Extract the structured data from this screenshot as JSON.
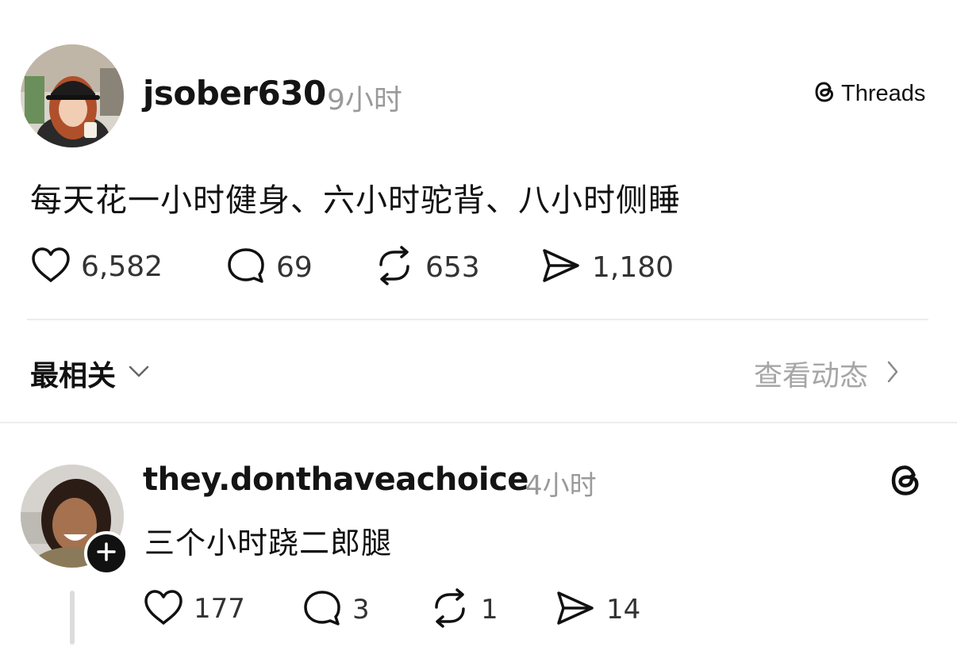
{
  "post": {
    "username": "jsober630",
    "time": "9小时",
    "badge_label": "Threads",
    "text": "每天花一小时健身、六小时驼背、八小时侧睡",
    "stats": {
      "likes": "6,582",
      "comments": "69",
      "reposts": "653",
      "shares": "1,180"
    }
  },
  "sort": {
    "label": "最相关",
    "activity_label": "查看动态"
  },
  "reply": {
    "username": "they.donthaveachoice",
    "time": "4小时",
    "text": "三个小时跷二郎腿",
    "stats": {
      "likes": "177",
      "comments": "3",
      "reposts": "1",
      "shares": "14"
    }
  },
  "icons": {
    "like": "heart-outline-icon",
    "comment": "speech-bubble-icon",
    "repost": "repost-arrows-icon",
    "share": "paper-plane-icon",
    "threads": "threads-logo-icon",
    "follow": "plus-icon"
  }
}
